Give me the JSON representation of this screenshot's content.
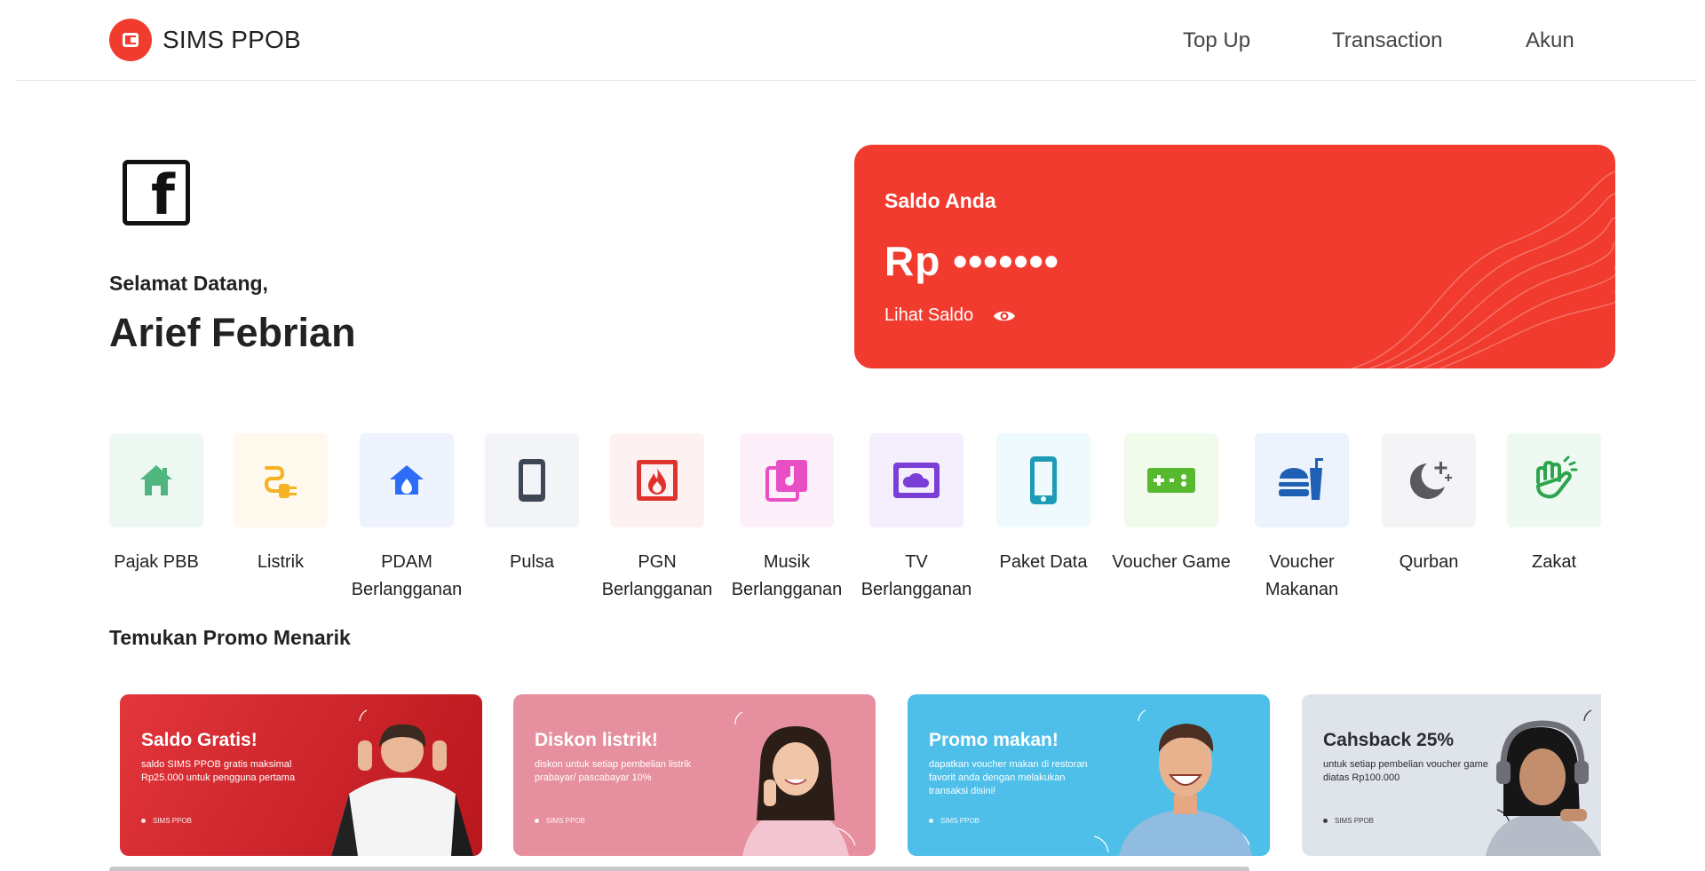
{
  "header": {
    "brand": "SIMS PPOB",
    "nav": {
      "top_up": "Top Up",
      "transaction": "Transaction",
      "account": "Akun"
    }
  },
  "profile": {
    "greeting": "Selamat Datang,",
    "name": "Arief Febrian",
    "avatar_icon": "facebook-icon"
  },
  "balance": {
    "label": "Saldo Anda",
    "value": "Rp •••••••",
    "toggle_label": "Lihat Saldo",
    "toggle_icon": "eye-icon",
    "card_color": "#f13b2f"
  },
  "services": [
    {
      "label": "Pajak PBB",
      "icon": "house-icon",
      "color": "#4fb67d"
    },
    {
      "label": "Listrik",
      "icon": "plug-icon",
      "color": "#f4b323"
    },
    {
      "label": "PDAM Berlangganan",
      "icon": "water-home-icon",
      "color": "#2c6cf6"
    },
    {
      "label": "Pulsa",
      "icon": "phone-icon",
      "color": "#3d4756"
    },
    {
      "label": "PGN Berlangganan",
      "icon": "fire-icon",
      "color": "#e0322c"
    },
    {
      "label": "Musik Berlangganan",
      "icon": "music-icon",
      "color": "#e94fc4"
    },
    {
      "label": "TV Berlangganan",
      "icon": "tv-cloud-icon",
      "color": "#7b3ed6"
    },
    {
      "label": "Paket Data",
      "icon": "mobile-data-icon",
      "color": "#1e9bb6"
    },
    {
      "label": "Voucher Game",
      "icon": "gamepad-icon",
      "color": "#56b92e"
    },
    {
      "label": "Voucher Makanan",
      "icon": "food-icon",
      "color": "#1f5fb4"
    },
    {
      "label": "Qurban",
      "icon": "moon-star-icon",
      "color": "#5a5a5e"
    },
    {
      "label": "Zakat",
      "icon": "hands-icon",
      "color": "#2ea44f"
    }
  ],
  "promo": {
    "title": "Temukan Promo Menarik",
    "items": [
      {
        "title": "Saldo Gratis!",
        "desc": "saldo SIMS PPOB gratis maksimal Rp25.000 untuk pengguna pertama",
        "brand": "SIMS PPOB",
        "bg": "#d9232a"
      },
      {
        "title": "Diskon listrik!",
        "desc": "diskon untuk setiap pembelian listrik prabayar/ pascabayar 10%",
        "brand": "SIMS PPOB",
        "bg": "#e6909f"
      },
      {
        "title": "Promo makan!",
        "desc": "dapatkan voucher makan di restoran favorit anda dengan melakukan transaksi disini!",
        "brand": "SIMS PPOB",
        "bg": "#4dbfe9"
      },
      {
        "title": "Cahsback 25%",
        "desc": "untuk setiap pembelian voucher game diatas Rp100.000",
        "brand": "SIMS PPOB",
        "bg": "#dfe3ea"
      }
    ]
  }
}
